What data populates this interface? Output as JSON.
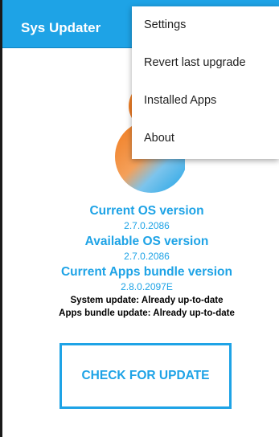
{
  "app_bar": {
    "title": "Sys Updater",
    "color": "#1ea3e6"
  },
  "overflow_menu": {
    "items": [
      {
        "label": "Settings"
      },
      {
        "label": "Revert last upgrade"
      },
      {
        "label": "Installed Apps"
      },
      {
        "label": "About"
      }
    ]
  },
  "versions": {
    "current_os_label": "Current OS version",
    "current_os_value": "2.7.0.2086",
    "available_os_label": "Available OS version",
    "available_os_value": "2.7.0.2086",
    "apps_bundle_label": "Current Apps bundle version",
    "apps_bundle_value": "2.8.0.2097E"
  },
  "status": {
    "system_update": "System update: Already up-to-date",
    "apps_bundle_update": "Apps bundle update: Already up-to-date"
  },
  "actions": {
    "check_for_update_label": "CHECK FOR UPDATE"
  },
  "colors": {
    "accent": "#1ea3e6",
    "logo_orange": "#f07a1d",
    "logo_blue": "#1ea3e6"
  }
}
